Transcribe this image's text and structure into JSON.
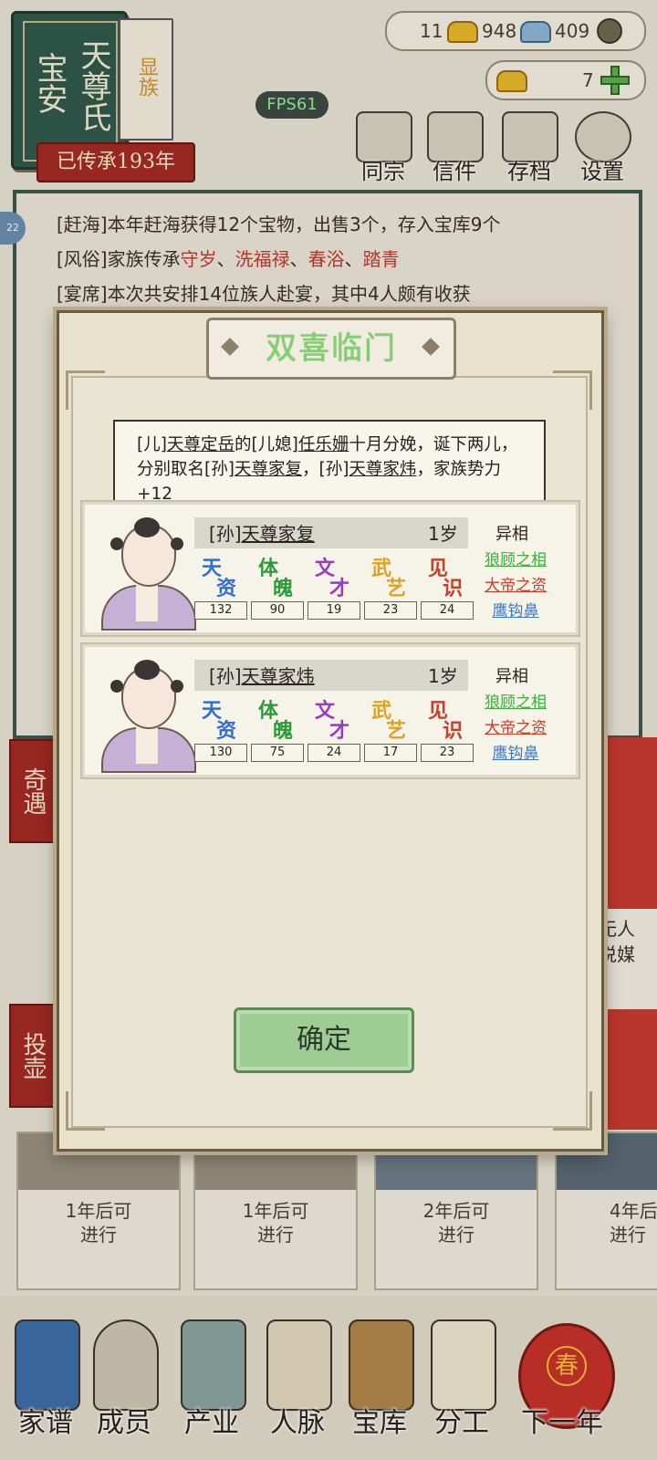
{
  "header": {
    "clan_name_col1": "宝安",
    "clan_name_col2": "天尊氏",
    "clan_tag": "显族",
    "inherit_label": "已传承193年",
    "fps": "FPS61",
    "resources": {
      "res1": "11",
      "res2": "948",
      "res3": "409",
      "ingots": "7"
    },
    "buttons": [
      "同宗",
      "信件",
      "存档",
      "设置"
    ]
  },
  "log": {
    "side_badge": "22",
    "lines": [
      "[赶海]本年赶海获得12个宝物，出售3个，存入宝库9个",
      "[风俗]家族传承",
      "[宴席]本次共安排14位族人赴宴，其中4人颇有收获"
    ],
    "customs": [
      "守岁",
      "洗福禄",
      "春浴",
      "踏青"
    ],
    "sep": "、"
  },
  "background": {
    "side_tab_1": "奇遇",
    "side_tab_2": "投壶",
    "right_text_1": "无人",
    "right_text_2": "说媒",
    "cards": [
      {
        "line1": "1年后可",
        "line2": "进行"
      },
      {
        "line1": "1年后可",
        "line2": "进行"
      },
      {
        "line1": "2年后可",
        "line2": "进行"
      },
      {
        "line1": "4年后",
        "line2": "进行"
      }
    ]
  },
  "modal": {
    "title": "双喜临门",
    "event": {
      "p1": "[儿]",
      "father": "天尊定岳",
      "p2": "的",
      "p3": "[儿媳]",
      "mother": "任乐姗",
      "p4": "十月分娩，诞下两儿，分别取名",
      "p5": "[孙]",
      "child1": "天尊家复",
      "p6": "，",
      "p7": "[孙]",
      "child2": "天尊家炜",
      "p8": "，家族势力+12"
    },
    "stat_names": [
      "天资",
      "体魄",
      "文才",
      "武艺",
      "见识"
    ],
    "stat_colors": [
      "#2f6fd6",
      "#2e9a3a",
      "#9a3ac4",
      "#e0a020",
      "#c8402a"
    ],
    "trait_header": "异相",
    "trait_colors": [
      "#3fae3f",
      "#d03a2a",
      "#3a78c8"
    ],
    "children": [
      {
        "prefix": "[孙]",
        "name": "天尊家复",
        "age": "1岁",
        "stats": [
          "132",
          "90",
          "19",
          "23",
          "24"
        ],
        "traits": [
          "狼顾之相",
          "大帝之资",
          "鹰钩鼻"
        ]
      },
      {
        "prefix": "[孙]",
        "name": "天尊家炜",
        "age": "1岁",
        "stats": [
          "130",
          "75",
          "24",
          "17",
          "23"
        ],
        "traits": [
          "狼顾之相",
          "大帝之资",
          "鹰钩鼻"
        ]
      }
    ],
    "confirm_label": "确定"
  },
  "nav": {
    "items": [
      "家谱",
      "成员",
      "产业",
      "人脉",
      "宝库",
      "分工",
      "下一年"
    ],
    "lantern_char": "春"
  }
}
